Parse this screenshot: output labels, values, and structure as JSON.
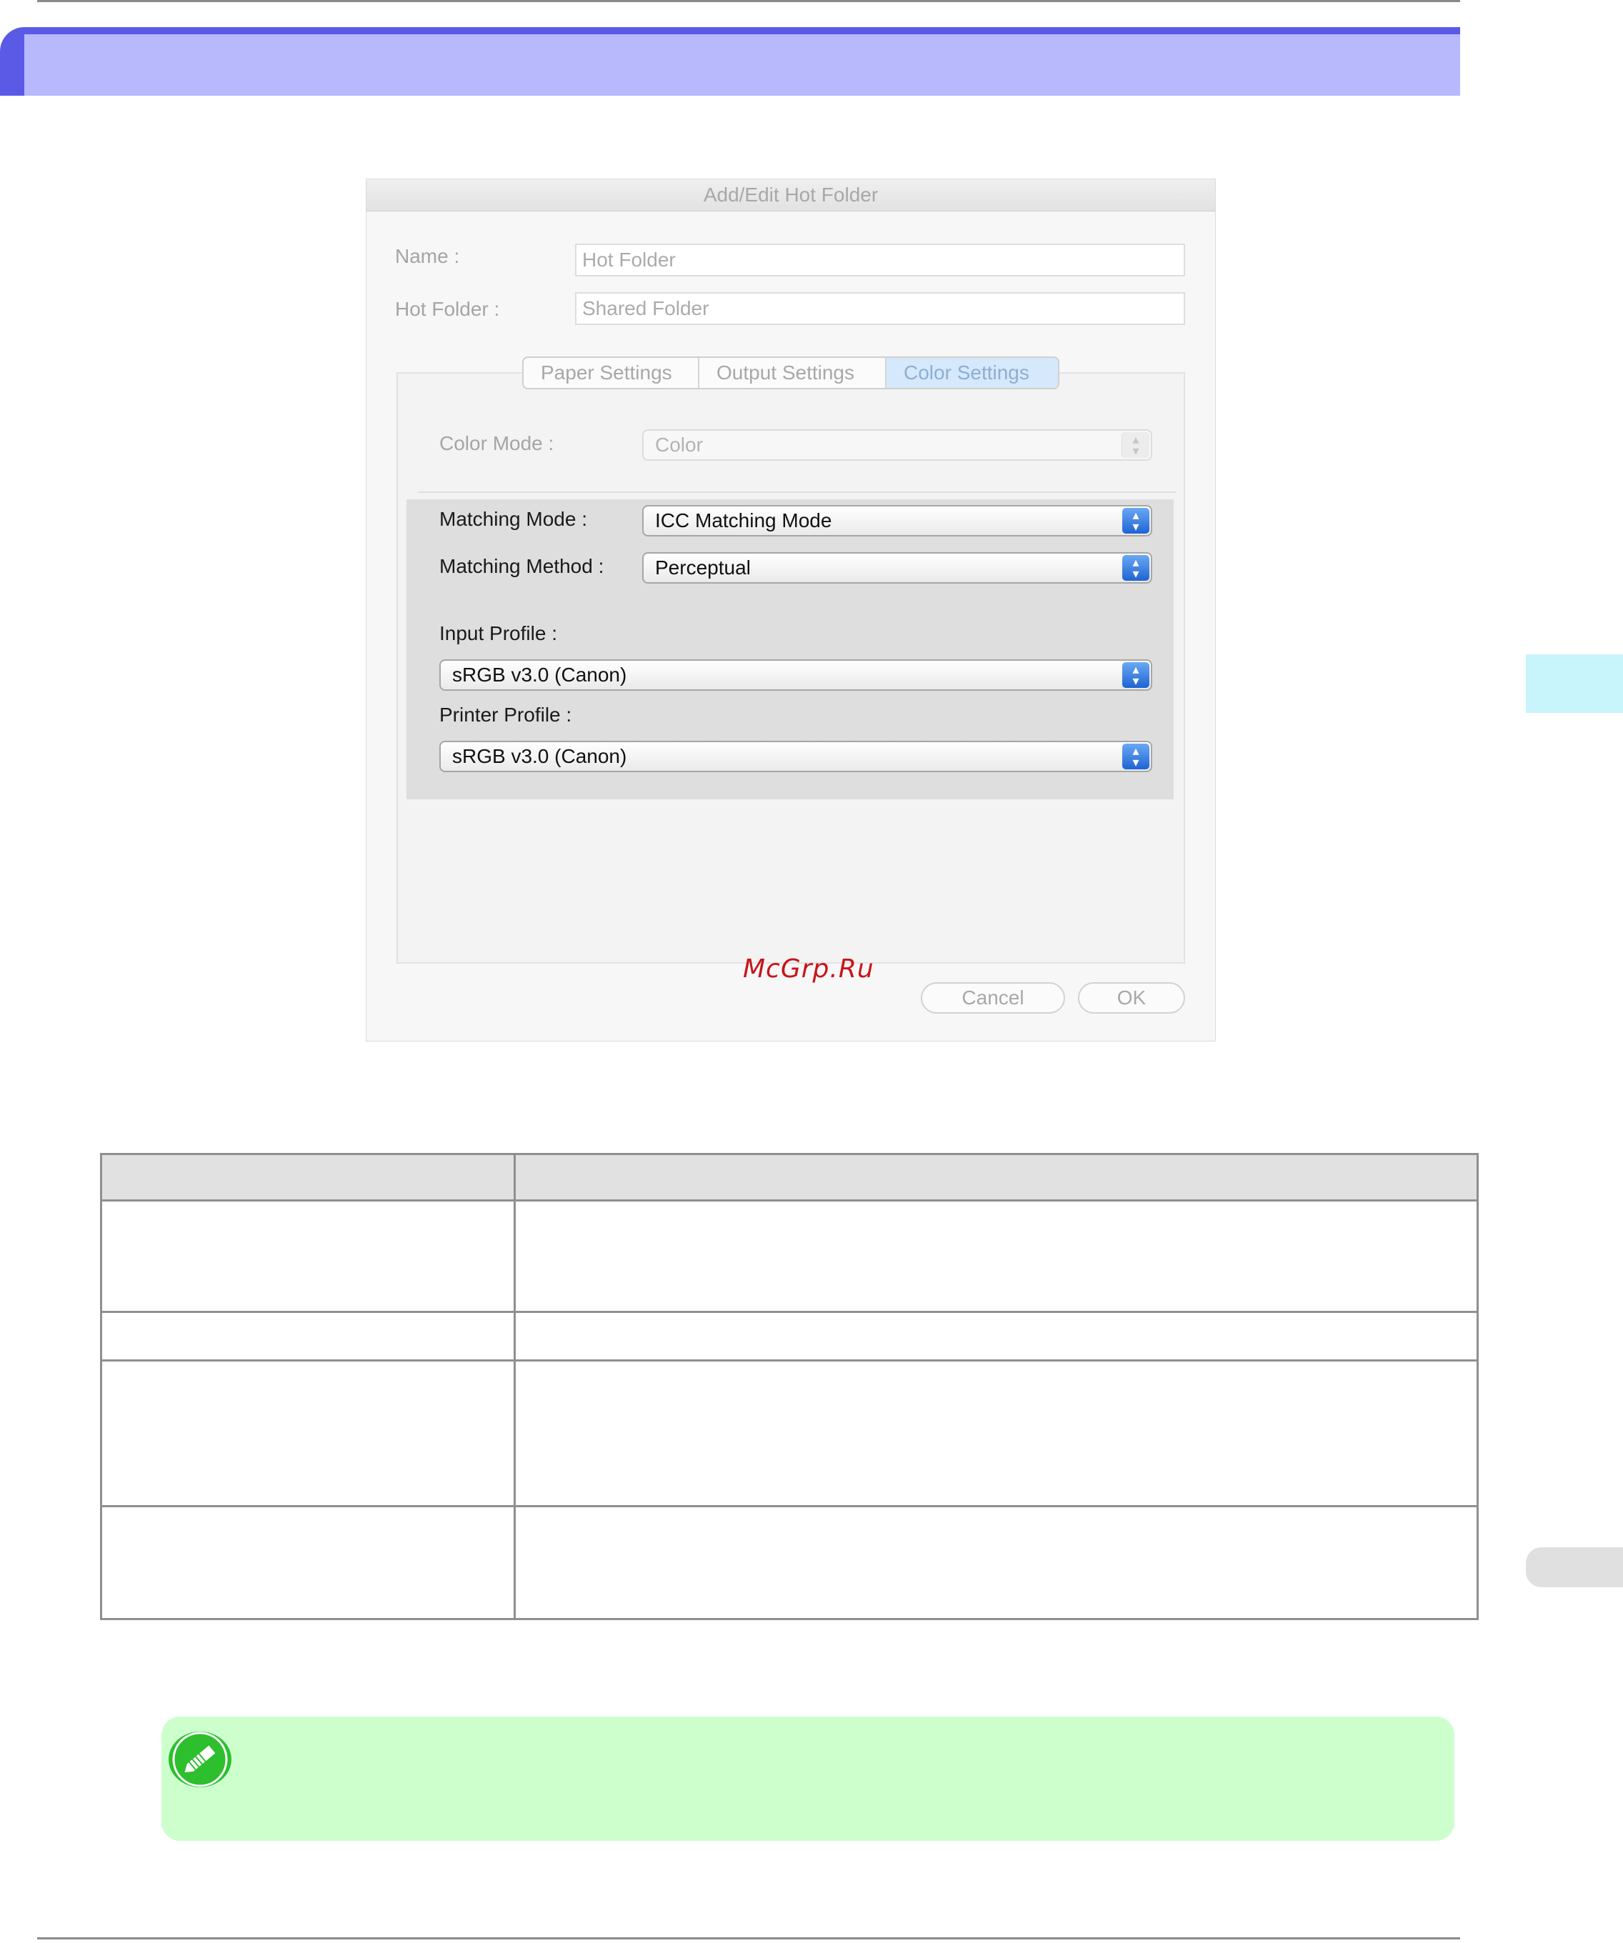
{
  "dialog": {
    "title": "Add/Edit Hot Folder",
    "name_label": "Name :",
    "name_value": "Hot Folder",
    "hot_folder_label": "Hot Folder :",
    "hot_folder_value": "Shared Folder",
    "tabs": [
      {
        "label": "Paper Settings",
        "active": false
      },
      {
        "label": "Output Settings",
        "active": false
      },
      {
        "label": "Color Settings",
        "active": true
      }
    ],
    "color_mode_label": "Color Mode :",
    "color_mode_value": "Color",
    "matching_mode_label": "Matching Mode :",
    "matching_mode_value": "ICC Matching Mode",
    "matching_method_label": "Matching Method :",
    "matching_method_value": "Perceptual",
    "input_profile_label": "Input Profile :",
    "input_profile_value": "sRGB v3.0 (Canon)",
    "printer_profile_label": "Printer Profile :",
    "printer_profile_value": "sRGB v3.0 (Canon)",
    "cancel_label": "Cancel",
    "ok_label": "OK"
  },
  "watermark": "McGrp.Ru",
  "colors": {
    "title_band": "#5a5ae6",
    "title_band_light": "#b8b8fc",
    "side_tab": "#c8f4fc",
    "note_bg": "#ccffcc",
    "watermark": "#c8141a",
    "stepper_blue": "#2f74e0"
  },
  "icons": {
    "note": "pencil-note-icon",
    "stepper": "up-down-arrows-icon"
  }
}
